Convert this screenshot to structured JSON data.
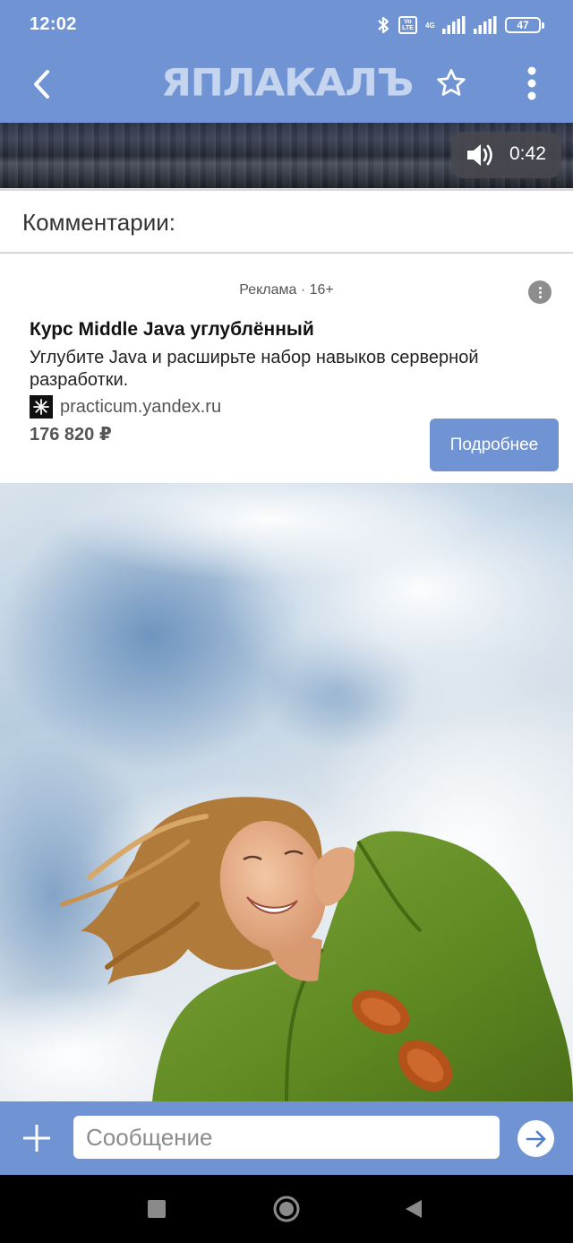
{
  "status_bar": {
    "time": "12:02",
    "volte": "Vo LTE",
    "network": "4G",
    "battery": "47"
  },
  "app_bar": {
    "logo": "ЯПЛАКАЛЪ",
    "back_icon": "chevron-left-icon",
    "favorite_icon": "star-outline-icon",
    "more_icon": "more-vertical-icon"
  },
  "video": {
    "duration": "0:42",
    "sound_icon": "speaker-icon"
  },
  "comments": {
    "title": "Комментарии:"
  },
  "ad": {
    "label": "Реклама · 16+",
    "title": "Курс Middle Java углублённый",
    "description": "Углубите Java и расширьте набор навыков серверной разработки.",
    "source": "practicum.yandex.ru",
    "price": "176 820 ₽",
    "cta": "Подробнее"
  },
  "message_bar": {
    "placeholder": "Сообщение",
    "value": "",
    "add_icon": "plus-icon",
    "send_icon": "arrow-right-icon"
  },
  "nav_bar": {
    "recents_icon": "square-icon",
    "home_icon": "circle-icon",
    "back_icon": "triangle-left-icon"
  },
  "colors": {
    "brand": "#6f93d3",
    "nav": "#000000"
  }
}
